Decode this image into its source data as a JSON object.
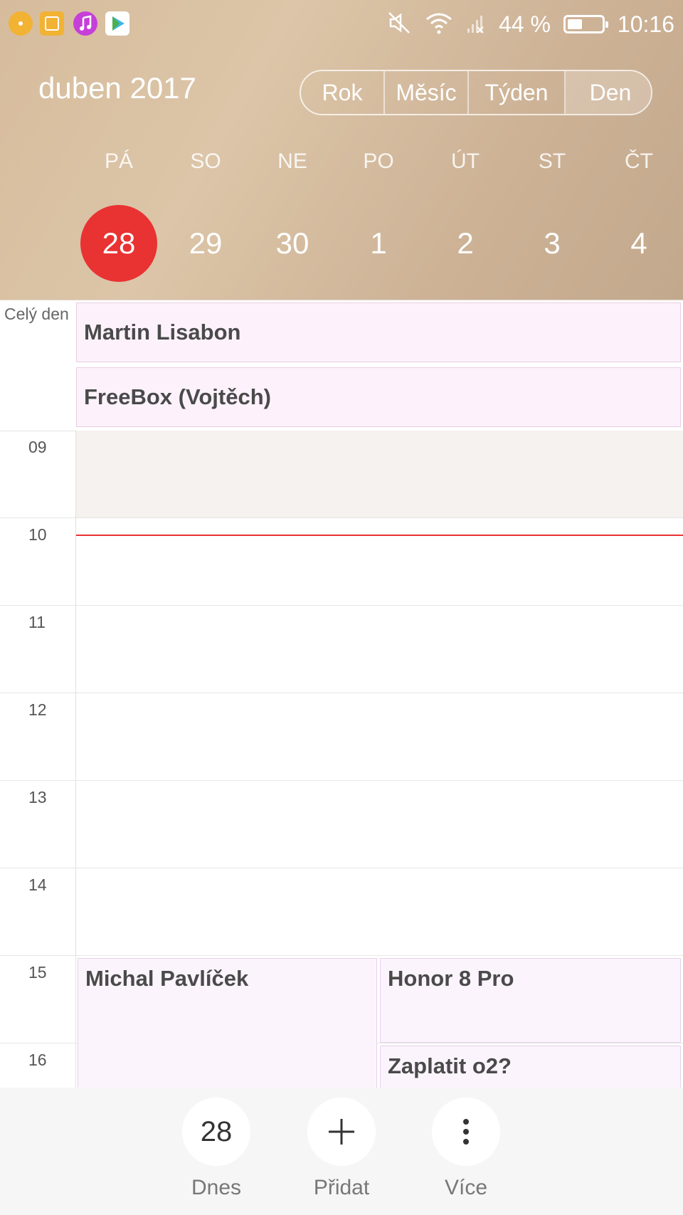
{
  "status_bar": {
    "battery_percent": "44 %",
    "battery_level": 0.44,
    "time": "10:16",
    "app_icons": [
      "notification-dot-icon",
      "slides-app-icon",
      "music-app-icon",
      "play-store-icon"
    ]
  },
  "header": {
    "month_title": "duben 2017",
    "views": [
      "Rok",
      "Měsíc",
      "Týden",
      "Den"
    ],
    "active_view": "Den"
  },
  "week": {
    "day_names": [
      "PÁ",
      "SO",
      "NE",
      "PO",
      "ÚT",
      "ST",
      "ČT"
    ],
    "dates": [
      "28",
      "29",
      "30",
      "1",
      "2",
      "3",
      "4"
    ],
    "selected_date": "28"
  },
  "all_day": {
    "label": "Celý den",
    "events": [
      "Martin Lisabon",
      "FreeBox (Vojtěch)"
    ]
  },
  "timeline": {
    "hours": [
      "09",
      "10",
      "11",
      "12",
      "13",
      "14",
      "15",
      "16"
    ],
    "events": [
      {
        "title": "Michal Pavlíček"
      },
      {
        "title": "Honor 8 Pro"
      },
      {
        "title": "Zaplatit o2?"
      }
    ]
  },
  "bottom_bar": {
    "today_number": "28",
    "today_label": "Dnes",
    "add_label": "Přidat",
    "more_label": "Více"
  },
  "colors": {
    "accent_red": "#e93232",
    "event_bg": "#fdf2fb"
  }
}
